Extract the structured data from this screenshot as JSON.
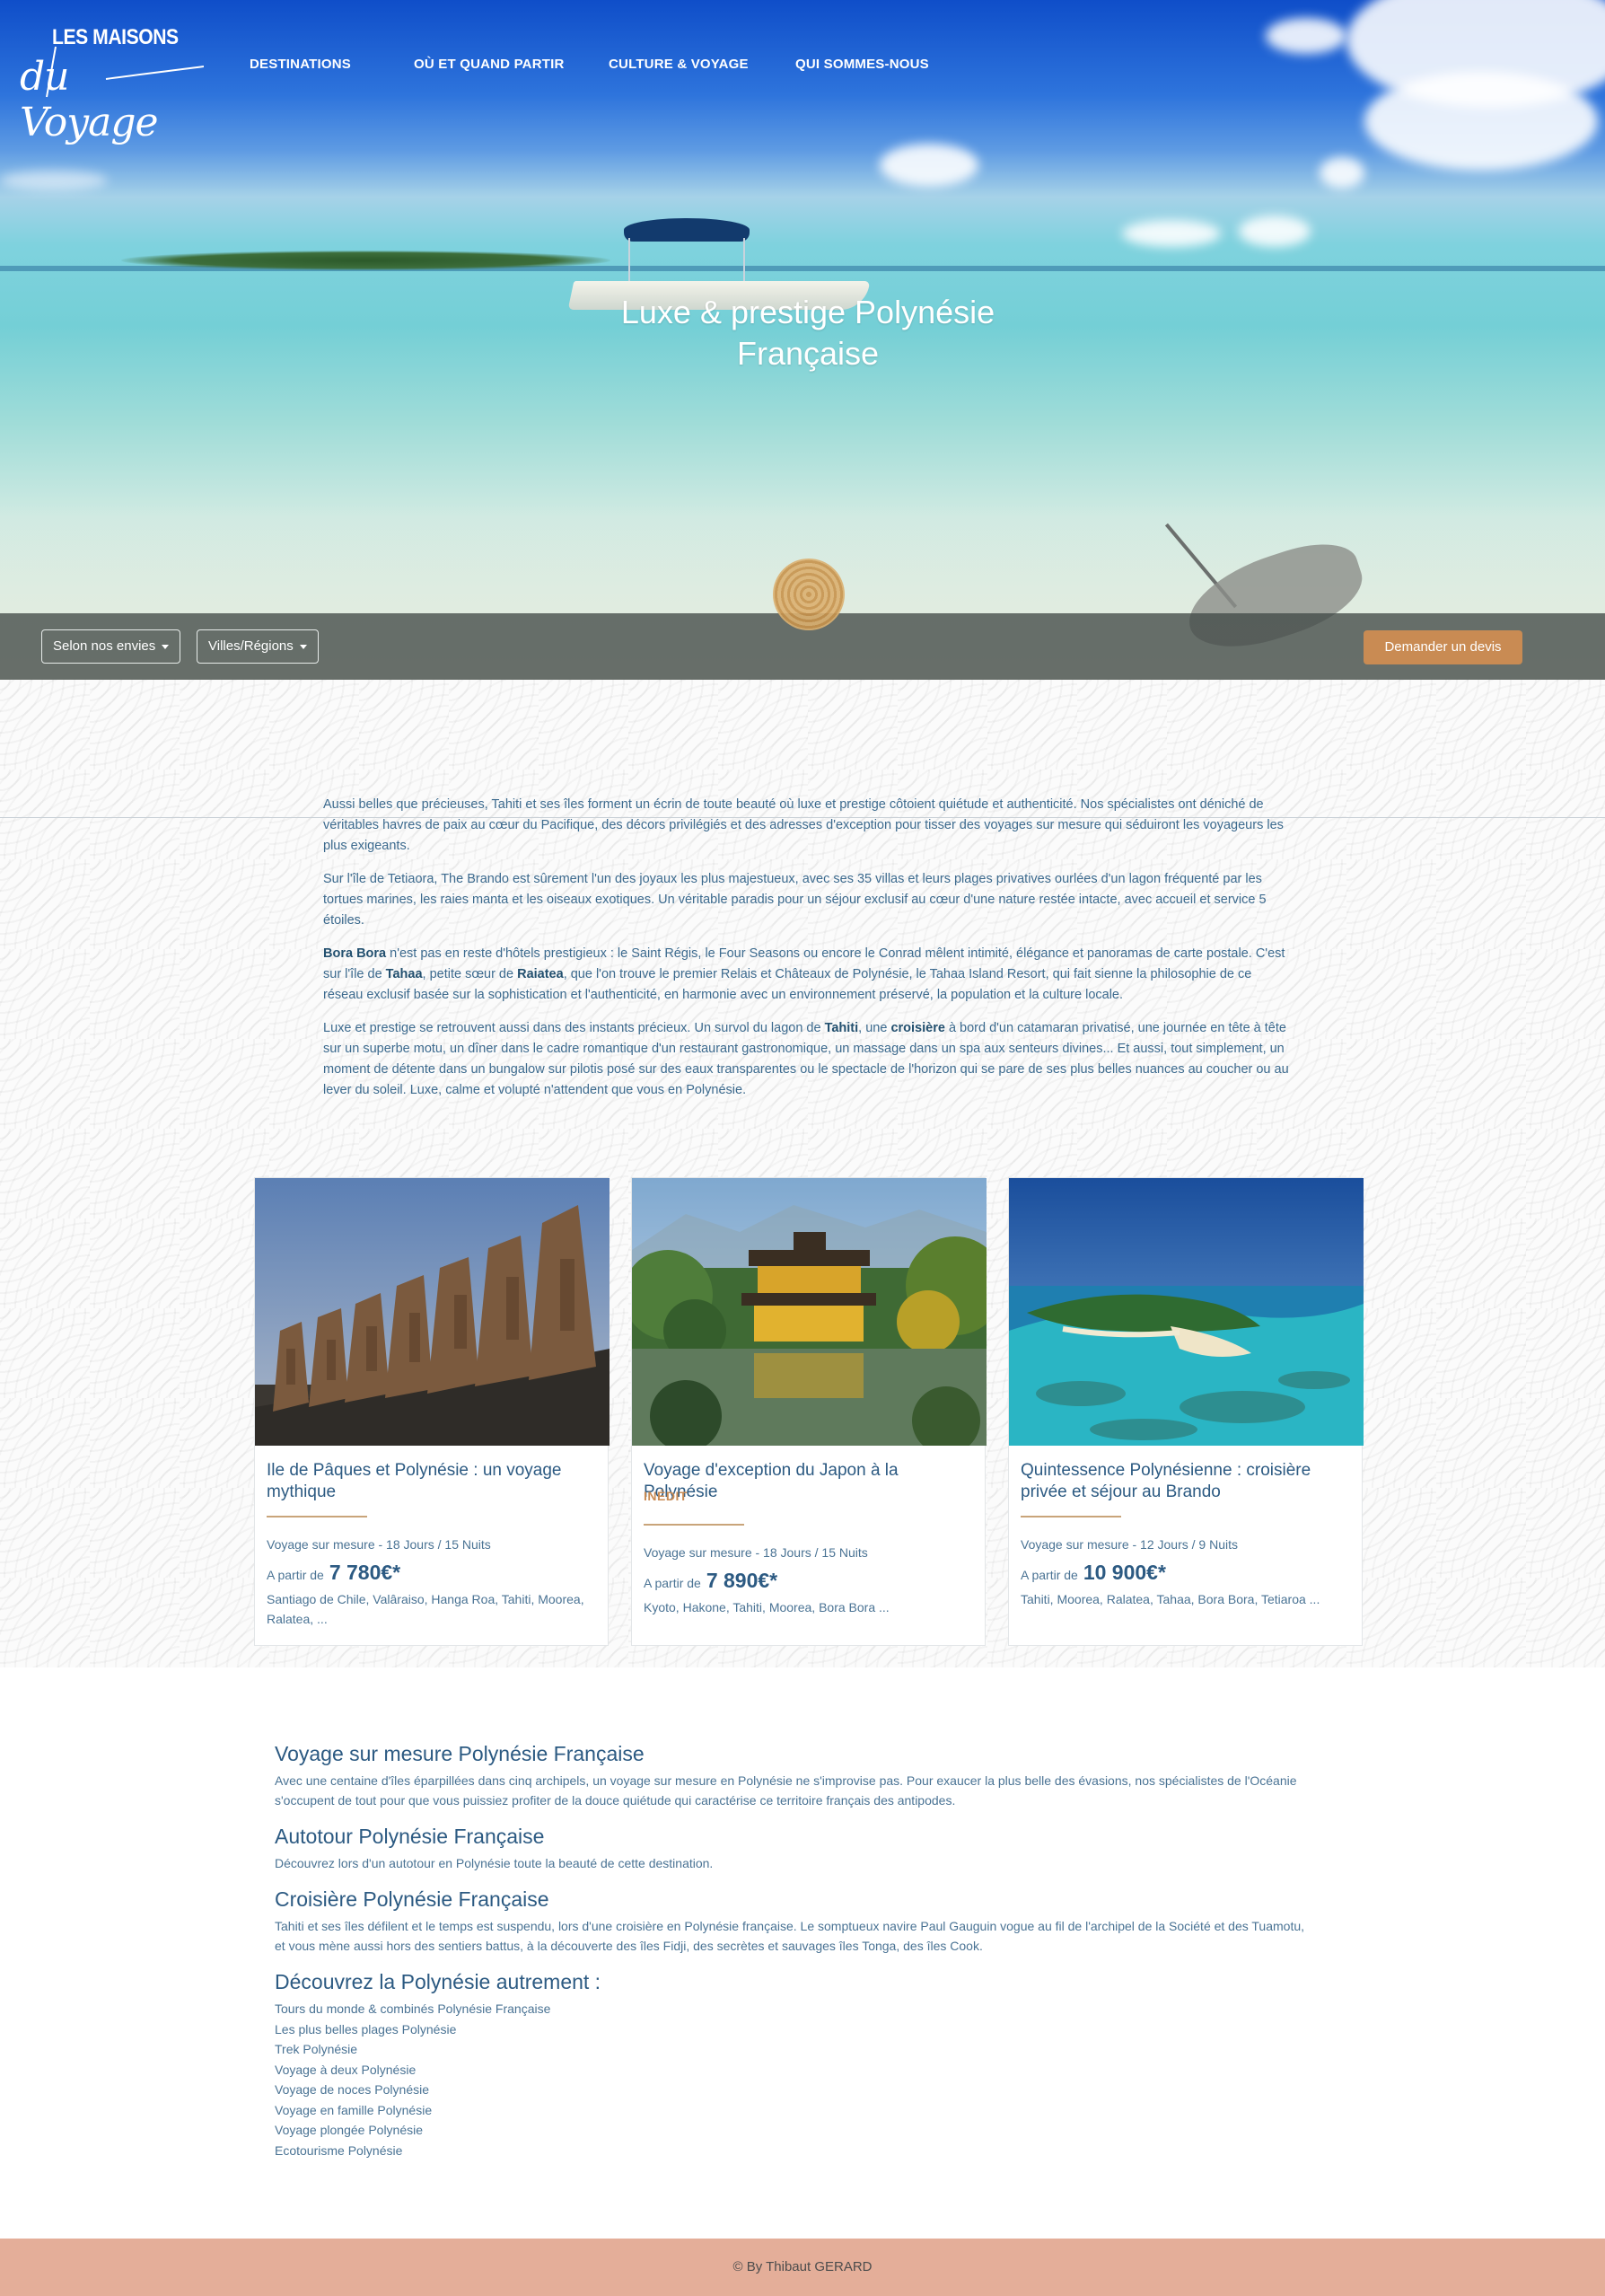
{
  "header": {
    "logo": {
      "line1": "LES MAISONS",
      "line2": "du Voyage"
    },
    "nav": [
      {
        "label": "DESTINATIONS"
      },
      {
        "label": "OÙ ET QUAND PARTIR"
      },
      {
        "label": "CULTURE & VOYAGE"
      },
      {
        "label": "QUI SOMMES-NOUS"
      }
    ]
  },
  "hero": {
    "title_line1": "Luxe & prestige Polynésie",
    "title_line2": "Française"
  },
  "filters": {
    "envies_label": "Selon nos envies",
    "regions_label": "Villes/Régions",
    "devis_label": "Demander un devis"
  },
  "intro": {
    "p1": "Aussi belles que précieuses, Tahiti et ses îles forment un écrin de toute beauté où luxe et prestige côtoient quiétude et authenticité. Nos spécialistes ont déniché de véritables havres de paix au cœur du Pacifique, des décors privilégiés et des adresses d'exception pour tisser des voyages sur mesure qui séduiront les voyageurs les plus exigeants.",
    "p2": "Sur l'île de Tetiaora, The Brando est sûrement l'un des joyaux les plus majestueux, avec ses 35 villas et leurs plages privatives ourlées d'un lagon fréquenté par les tortues marines, les raies manta et les oiseaux exotiques. Un véritable paradis pour un séjour exclusif au cœur d'une nature restée intacte, avec accueil et service 5 étoiles.",
    "p3_b1": "Bora Bora",
    "p3_t1": " n'est pas en reste d'hôtels prestigieux : le Saint Régis, le Four Seasons ou encore le Conrad mêlent intimité, élégance et panoramas de carte postale. C'est sur l'île de ",
    "p3_b2": "Tahaa",
    "p3_t2": ", petite sœur de ",
    "p3_b3": "Raiatea",
    "p3_t3": ", que l'on trouve le premier Relais et Châteaux de Polynésie, le Tahaa Island Resort, qui fait sienne la philosophie de ce réseau exclusif basée sur la sophistication et l'authenticité, en harmonie avec un environnement préservé, la population et la culture locale.",
    "p4_t1": "Luxe et prestige se retrouvent aussi dans des instants précieux. Un survol du lagon de ",
    "p4_b1": "Tahiti",
    "p4_t2": ", une ",
    "p4_b2": "croisière",
    "p4_t3": " à bord d'un catamaran privatisé, une journée en tête à tête sur un superbe motu, un dîner dans le cadre romantique d'un restaurant gastronomique, un massage dans un spa aux senteurs divines... Et aussi, tout simplement, un moment de détente dans un bungalow sur pilotis posé sur des eaux transparentes ou le spectacle de l'horizon qui se pare de ses plus belles nuances au coucher ou au lever du soleil. Luxe, calme et volupté n'attendent que vous en Polynésie."
  },
  "cards": [
    {
      "title": "Ile de Pâques et Polynésie : un voyage mythique",
      "badge": "",
      "meta": "Voyage sur mesure - 18 Jours / 15 Nuits",
      "price_prefix": "A partir de",
      "price": "7 780€*",
      "places": "Santiago de Chile, Valâraiso, Hanga Roa, Tahiti, Moorea, Ralatea, ..."
    },
    {
      "title": "Voyage d'exception du Japon à la Polynésie",
      "badge": "INÉDIT",
      "meta": "Voyage sur mesure - 18 Jours / 15 Nuits",
      "price_prefix": "A partir de",
      "price": "7 890€*",
      "places": "Kyoto, Hakone, Tahiti, Moorea, Bora Bora ..."
    },
    {
      "title": "Quintessence Polynésienne : croisière privée et séjour au Brando",
      "badge": "",
      "meta": "Voyage sur mesure - 12 Jours / 9 Nuits",
      "price_prefix": "A partir de",
      "price": "10 900€*",
      "places": "Tahiti, Moorea, Ralatea, Tahaa, Bora Bora, Tetiaroa ..."
    }
  ],
  "seo": {
    "h1": "Voyage sur mesure Polynésie Française",
    "p1": "Avec une centaine d'îles éparpillées dans cinq archipels, un voyage sur mesure en Polynésie ne s'improvise pas. Pour exaucer la plus belle des évasions, nos spécialistes de l'Océanie s'occupent de tout pour que vous puissiez profiter de la douce quiétude qui caractérise ce territoire français des antipodes.",
    "h2": "Autotour Polynésie Française",
    "p2": "Découvrez lors d'un autotour en Polynésie toute la beauté de cette destination.",
    "h3": "Croisière Polynésie Française",
    "p3": "Tahiti et ses îles défilent et le temps est suspendu, lors d'une croisière en Polynésie française. Le somptueux navire Paul Gauguin vogue au fil de l'archipel de la Société et des Tuamotu, et vous mène aussi hors des sentiers battus, à la découverte des îles Fidji, des secrètes et sauvages îles Tonga, des îles Cook.",
    "h4": "Découvrez la Polynésie autrement :",
    "links": [
      "Tours du monde & combinés Polynésie Française",
      "Les plus belles plages Polynésie",
      "Trek Polynésie",
      "Voyage à deux Polynésie",
      "Voyage de noces Polynésie",
      "Voyage en famille Polynésie",
      "Voyage plongée Polynésie",
      "Ecotourisme Polynésie"
    ]
  },
  "footer": {
    "text": "© By Thibaut GERARD"
  },
  "colors": {
    "accent": "#c98b53",
    "text": "#2c5a82",
    "footer": "#e4ae99"
  }
}
